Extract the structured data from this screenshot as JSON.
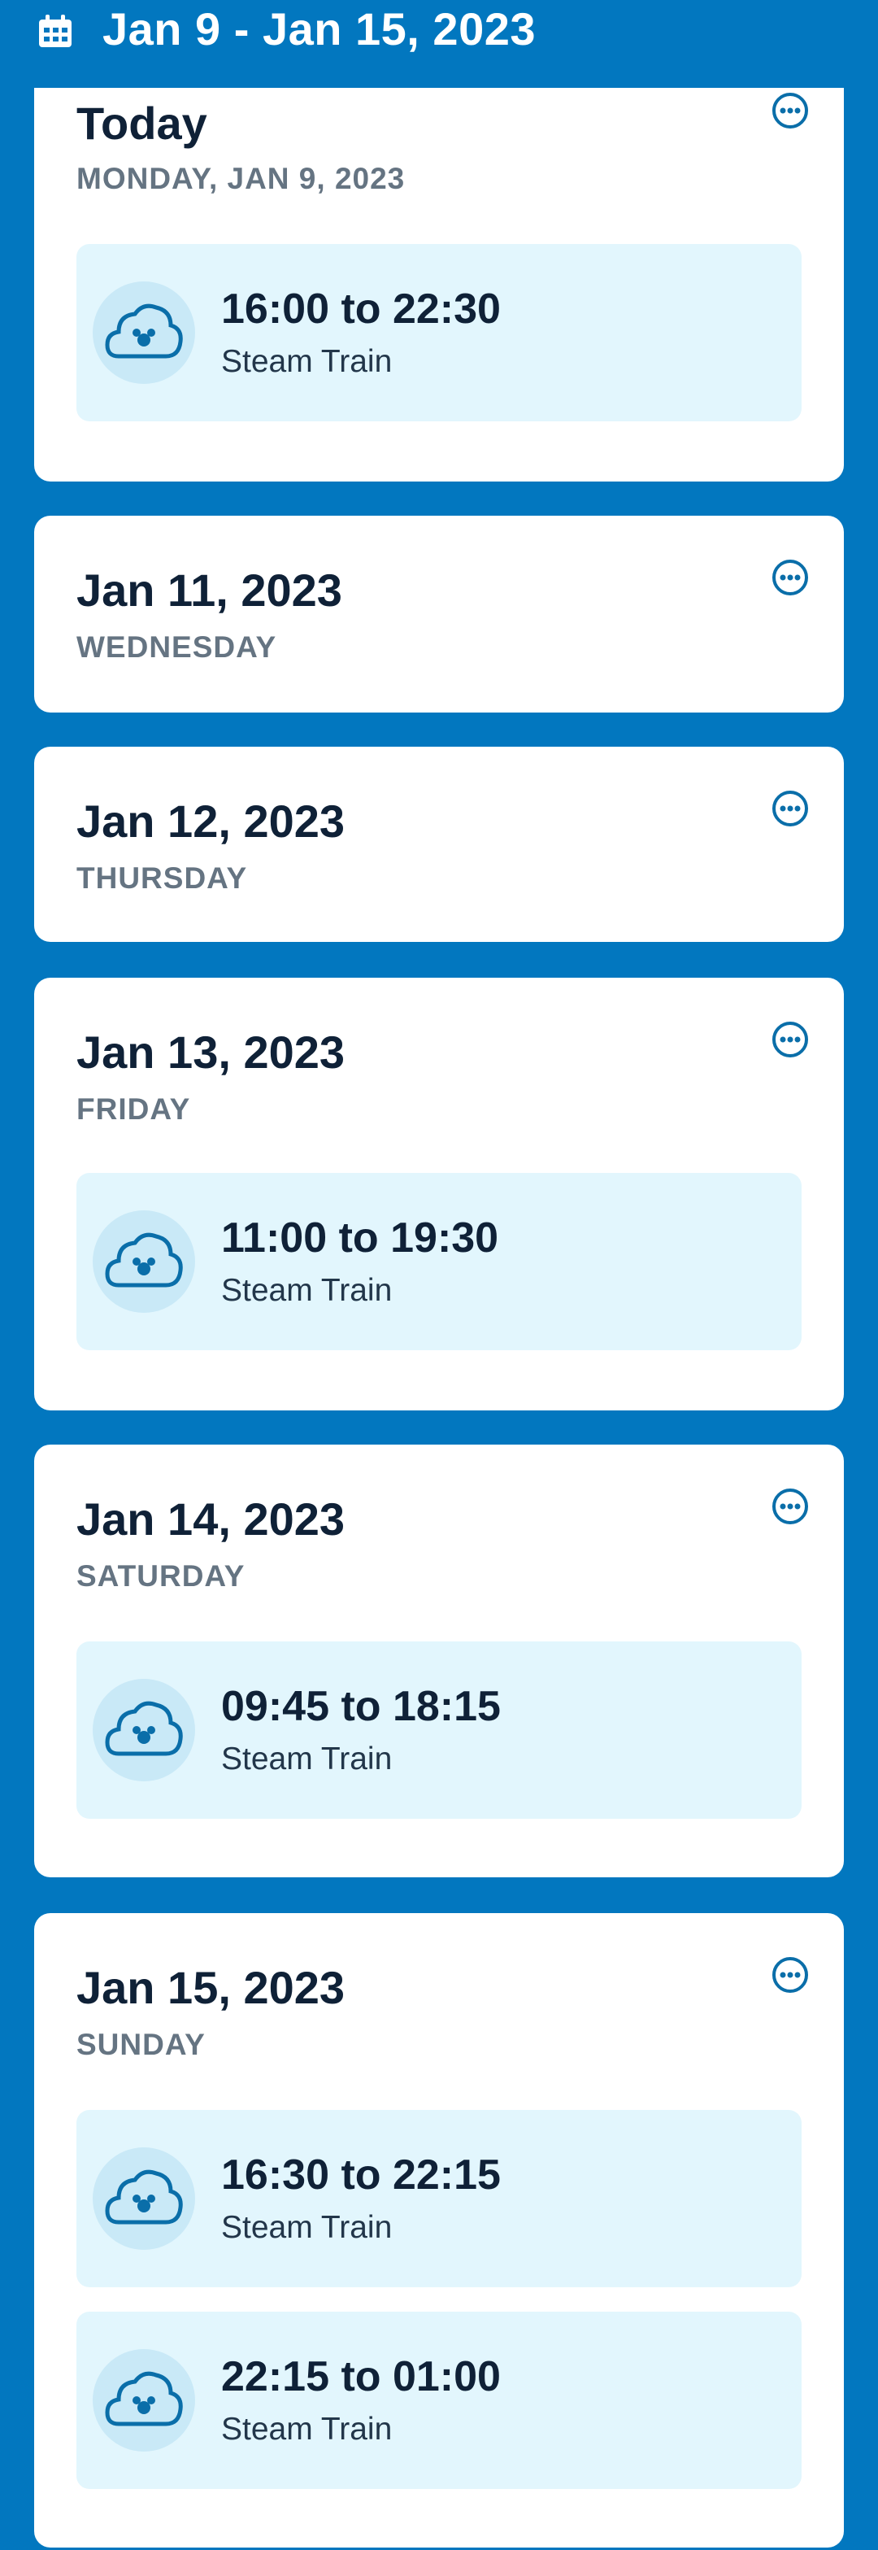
{
  "header": {
    "title": "Jan 9 - Jan 15, 2023",
    "icon": "calendar-icon"
  },
  "colors": {
    "background": "#0277bf",
    "card": "#ffffff",
    "slot": "#e2f6fd",
    "accent": "#0a6ea9"
  },
  "days": [
    {
      "date": "Today",
      "weekday": "MONDAY, JAN 9, 2023",
      "slots": [
        {
          "time": "16:00 to 22:30",
          "name": "Steam Train"
        }
      ]
    },
    {
      "date": "Jan 11, 2023",
      "weekday": "WEDNESDAY",
      "slots": []
    },
    {
      "date": "Jan 12, 2023",
      "weekday": "THURSDAY",
      "slots": []
    },
    {
      "date": "Jan 13, 2023",
      "weekday": "FRIDAY",
      "slots": [
        {
          "time": "11:00 to 19:30",
          "name": "Steam Train"
        }
      ]
    },
    {
      "date": "Jan 14, 2023",
      "weekday": "SATURDAY",
      "slots": [
        {
          "time": "09:45 to 18:15",
          "name": "Steam Train"
        }
      ]
    },
    {
      "date": "Jan 15, 2023",
      "weekday": "SUNDAY",
      "slots": [
        {
          "time": "16:30 to 22:15",
          "name": "Steam Train"
        },
        {
          "time": "22:15 to 01:00",
          "name": "Steam Train"
        }
      ]
    }
  ]
}
